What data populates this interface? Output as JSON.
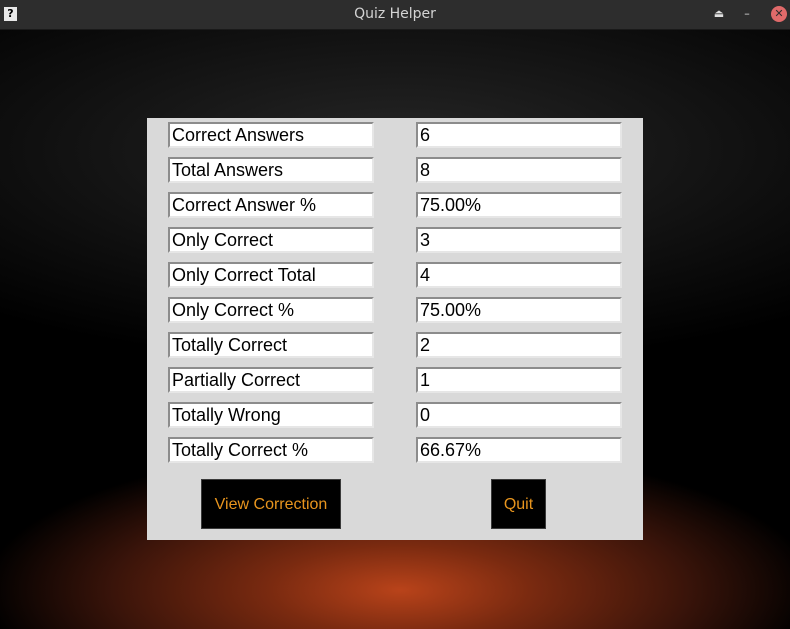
{
  "window": {
    "title": "Quiz Helper",
    "app_icon": "?",
    "controls": {
      "eject_icon": "⏏",
      "minimize_icon": "–",
      "close_icon": "✕"
    }
  },
  "colors": {
    "button_bg": "#000000",
    "button_text": "#e8951e",
    "dialog_bg": "#d9d9d9"
  },
  "stats": [
    {
      "label": "Correct Answers",
      "value": "6"
    },
    {
      "label": "Total Answers",
      "value": "8"
    },
    {
      "label": "Correct Answer %",
      "value": "75.00%"
    },
    {
      "label": "Only Correct",
      "value": "3"
    },
    {
      "label": "Only Correct Total",
      "value": "4"
    },
    {
      "label": "Only Correct %",
      "value": "75.00%"
    },
    {
      "label": "Totally Correct",
      "value": "2"
    },
    {
      "label": "Partially Correct",
      "value": "1"
    },
    {
      "label": "Totally Wrong",
      "value": "0"
    },
    {
      "label": "Totally Correct %",
      "value": "66.67%"
    }
  ],
  "buttons": {
    "view_correction": "View Correction",
    "quit": "Quit"
  }
}
